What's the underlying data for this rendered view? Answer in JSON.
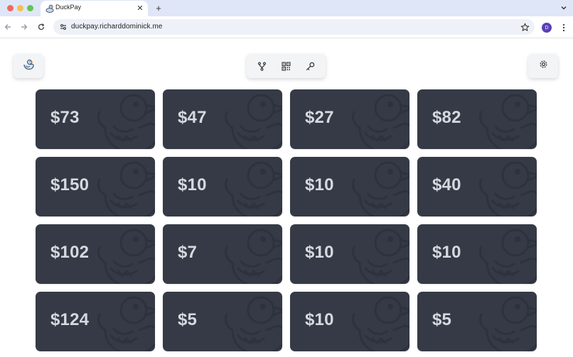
{
  "browser": {
    "tab_title": "DuckPay",
    "new_tab_label": "+",
    "url": "duckpay.richarddominick.me",
    "profile_initial": "D"
  },
  "app": {
    "toolbar_icons": [
      "split-icon",
      "qr-code-icon",
      "key-icon"
    ],
    "cards": [
      {
        "amount": "$73"
      },
      {
        "amount": "$47"
      },
      {
        "amount": "$27"
      },
      {
        "amount": "$82"
      },
      {
        "amount": "$150"
      },
      {
        "amount": "$10"
      },
      {
        "amount": "$10"
      },
      {
        "amount": "$40"
      },
      {
        "amount": "$102"
      },
      {
        "amount": "$7"
      },
      {
        "amount": "$10"
      },
      {
        "amount": "$10"
      },
      {
        "amount": "$124"
      },
      {
        "amount": "$5"
      },
      {
        "amount": "$10"
      },
      {
        "amount": "$5"
      }
    ]
  },
  "colors": {
    "card_bg": "#353a46",
    "card_text": "#d6d9df",
    "tab_strip": "#dfe6f7",
    "accent_avatar": "#5b3fb8"
  }
}
